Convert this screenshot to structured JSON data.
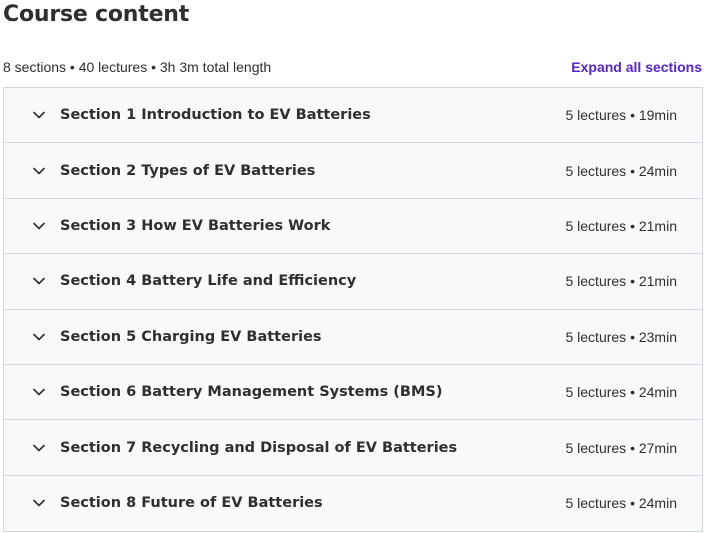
{
  "header": {
    "title": "Course content",
    "summary": "8 sections • 40 lectures • 3h 3m total length",
    "expand_label": "Expand all sections"
  },
  "sections": [
    {
      "title": "Section 1 Introduction to EV Batteries",
      "meta": "5 lectures • 19min"
    },
    {
      "title": "Section 2 Types of EV Batteries",
      "meta": "5 lectures • 24min"
    },
    {
      "title": "Section 3 How EV Batteries Work",
      "meta": "5 lectures • 21min"
    },
    {
      "title": "Section 4 Battery Life and Efficiency",
      "meta": "5 lectures • 21min"
    },
    {
      "title": "Section 5 Charging EV Batteries",
      "meta": "5 lectures • 23min"
    },
    {
      "title": "Section 6 Battery Management Systems (BMS)",
      "meta": "5 lectures • 24min"
    },
    {
      "title": "Section 7 Recycling and Disposal of EV Batteries",
      "meta": "5 lectures • 27min"
    },
    {
      "title": "Section 8 Future of EV Batteries",
      "meta": "5 lectures • 24min"
    }
  ],
  "icons": {
    "section_toggle": "chevron-down-icon"
  },
  "colors": {
    "text": "#2d2f31",
    "link": "#5624d0",
    "section_bg": "#f7f9fa",
    "border": "#d1d7dc"
  }
}
